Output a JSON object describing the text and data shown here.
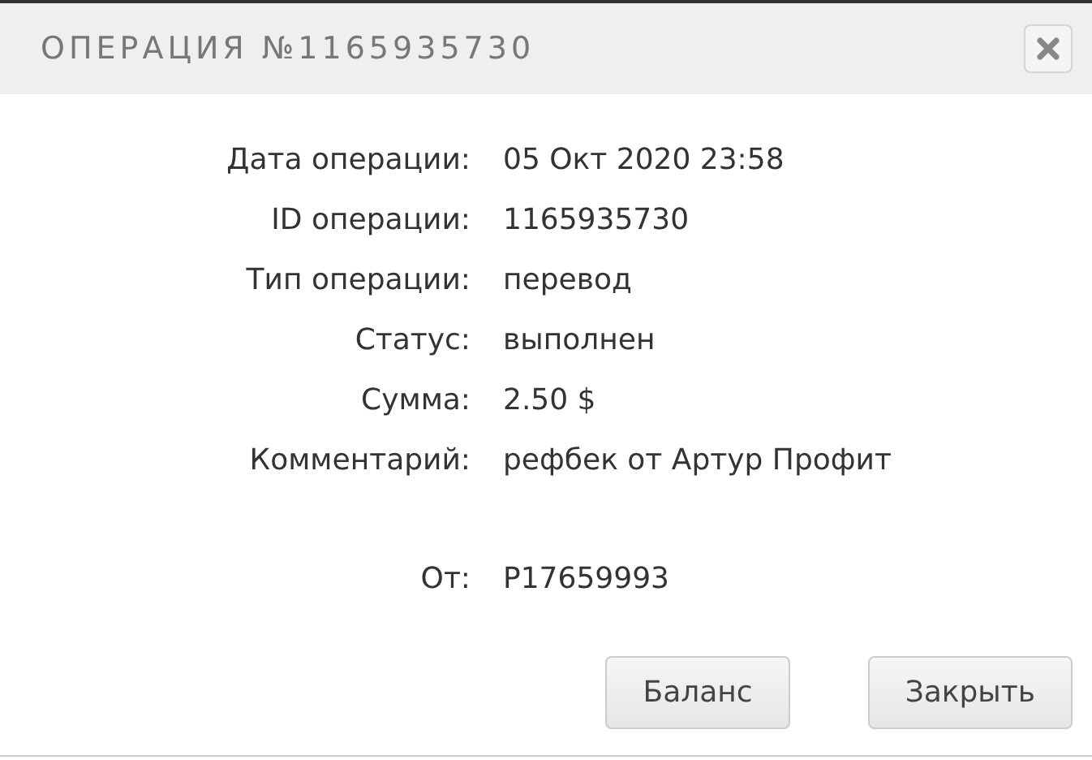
{
  "dialog": {
    "title": "ОПЕРАЦИЯ №1165935730"
  },
  "fields": [
    {
      "label": "Дата операции:",
      "value": "05 Окт 2020 23:58"
    },
    {
      "label": "ID операции:",
      "value": "1165935730"
    },
    {
      "label": "Тип операции:",
      "value": "перевод"
    },
    {
      "label": "Статус:",
      "value": "выполнен"
    },
    {
      "label": "Сумма:",
      "value": "2.50 $"
    },
    {
      "label": "Комментарий:",
      "value": "рефбек от Артур Профит"
    }
  ],
  "sender_fields": [
    {
      "label": "От:",
      "value": "P17659993"
    }
  ],
  "buttons": [
    "Баланс",
    "Закрыть"
  ]
}
